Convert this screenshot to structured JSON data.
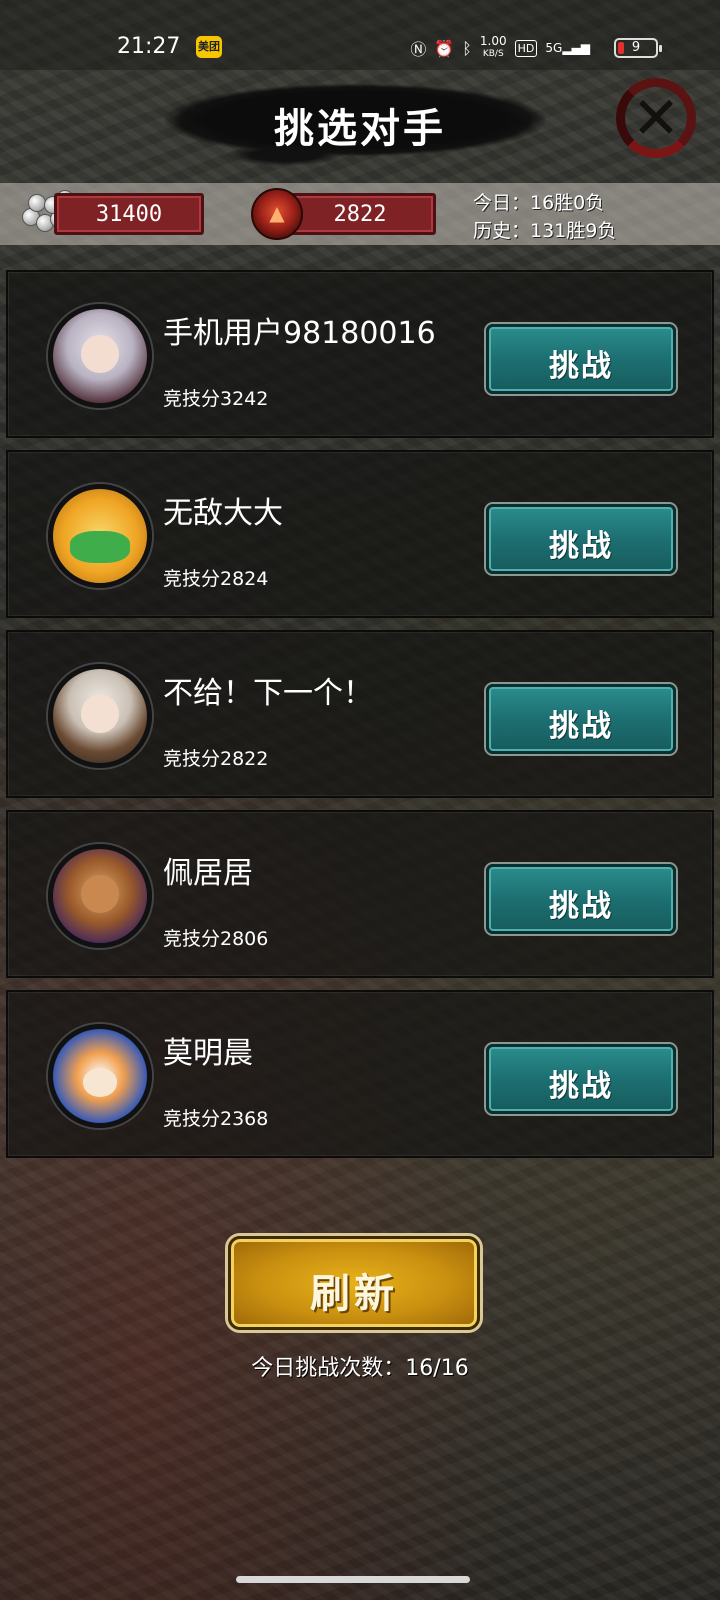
{
  "status_bar": {
    "time": "21:27",
    "app_badge": "美团",
    "net_speed_top": "1.00",
    "net_speed_unit": "KB/S",
    "hd": "HD",
    "signal": "5G",
    "battery": "9"
  },
  "header": {
    "title": "挑选对手",
    "close_icon": "close-x-icon"
  },
  "resources": {
    "silver": "31400",
    "dragon_points": "2822",
    "today_record": "今日：16胜0负",
    "history_record": "历史：131胜9负"
  },
  "opponents": [
    {
      "name": "手机用户98180016",
      "score": "竞技分3242",
      "button": "挑战"
    },
    {
      "name": "无敌大大",
      "score": "竞技分2824",
      "button": "挑战"
    },
    {
      "name": "不给！下一个！",
      "score": "竞技分2822",
      "button": "挑战"
    },
    {
      "name": "佩居居",
      "score": "竞技分2806",
      "button": "挑战"
    },
    {
      "name": "莫明晨",
      "score": "竞技分2368",
      "button": "挑战"
    }
  ],
  "refresh": {
    "label": "刷新",
    "count_text": "今日挑战次数：16/16"
  }
}
